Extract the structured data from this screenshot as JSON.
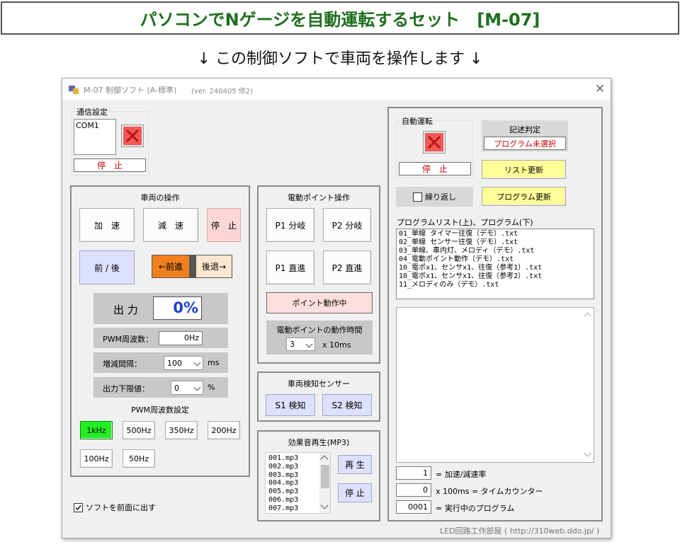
{
  "banner": {
    "title": "パソコンでNゲージを自動運転するセット　[M-07]"
  },
  "subtitle": "↓ この制御ソフトで車両を操作します ↓",
  "window": {
    "title": "M-07 制御ソフト (A-標準)",
    "version": "(ver. 240405 修2)",
    "close": "✕"
  },
  "comm": {
    "label": "通信設定",
    "port": "COM1",
    "status": "停　止"
  },
  "vehicle": {
    "label": "車両の操作",
    "accel": "加　速",
    "decel": "減　速",
    "stop": "停　止",
    "direction": "前 / 後",
    "forward": "←前進",
    "backward": "後退→",
    "output_label": "出 力",
    "output_value": "0%",
    "pwm_label": "PWM周波数：",
    "pwm_value": "0Hz",
    "step_label": "増減間隔：",
    "step_value": "100",
    "step_unit": "ms",
    "minout_label": "出力下限値：",
    "minout_value": "0",
    "minout_unit": "%",
    "pwm_setting_label": "PWM周波数設定",
    "freqs": [
      "1kHz",
      "500Hz",
      "350Hz",
      "200Hz",
      "100Hz",
      "50Hz"
    ]
  },
  "points": {
    "label": "電動ポイント操作",
    "p1_branch": "P1 分岐",
    "p2_branch": "P2 分岐",
    "p1_straight": "P1 直進",
    "p2_straight": "P2 直進",
    "busy": "ポイント動作中",
    "time_label": "電動ポイントの動作時間",
    "time_value": "3",
    "time_unit": "x 10ms"
  },
  "sensor": {
    "label": "車両検知センサー",
    "s1": "S1 検知",
    "s2": "S2 検知"
  },
  "sound": {
    "label": "効果音再生(MP3)",
    "files": [
      "001.mp3",
      "002.mp3",
      "003.mp3",
      "004.mp3",
      "005.mp3",
      "006.mp3",
      "007.mp3"
    ],
    "play": "再 生",
    "stop": "停 止"
  },
  "front_checkbox": "ソフトを前面に出す",
  "auto": {
    "label": "自動運転",
    "status": "停　止",
    "check_label": "記述判定",
    "check_value": "プログラム未選択",
    "list_update": "リスト更新",
    "repeat": "繰り返し",
    "program_update": "プログラム更新",
    "list_label": "プログラムリスト(上)、プログラム(下)",
    "programs": [
      "01_単線 タイマー往復（デモ）.txt",
      "02_単線 センサー往復（デモ）.txt",
      "03_単線、車内灯、メロディ（デモ）.txt",
      "04_電動ポイント動作（デモ）.txt",
      "10_電ポx1、センサx1、往復（参考1）.txt",
      "10_電ポx1、センサx1、往復（参考2）.txt",
      "11_メロディのみ（デモ）.txt"
    ],
    "accel_rate_value": "1",
    "accel_rate_label": "= 加速/減速率",
    "time_counter_value": "0",
    "time_counter_label": "x 100ms = タイムカウンター",
    "running_value": "0001",
    "running_label": "= 実行中のプログラム"
  },
  "footer": "LED回路工作部屋 ( http://310web.ddo.jp/ )",
  "colors": {
    "banner_text": "#1f6e1f",
    "stop_text": "#c00000",
    "output_text": "#1a3fd0",
    "forward_bg": "#f07f1e",
    "freq_active": "#22ee22",
    "update_bg": "#ffff99"
  }
}
